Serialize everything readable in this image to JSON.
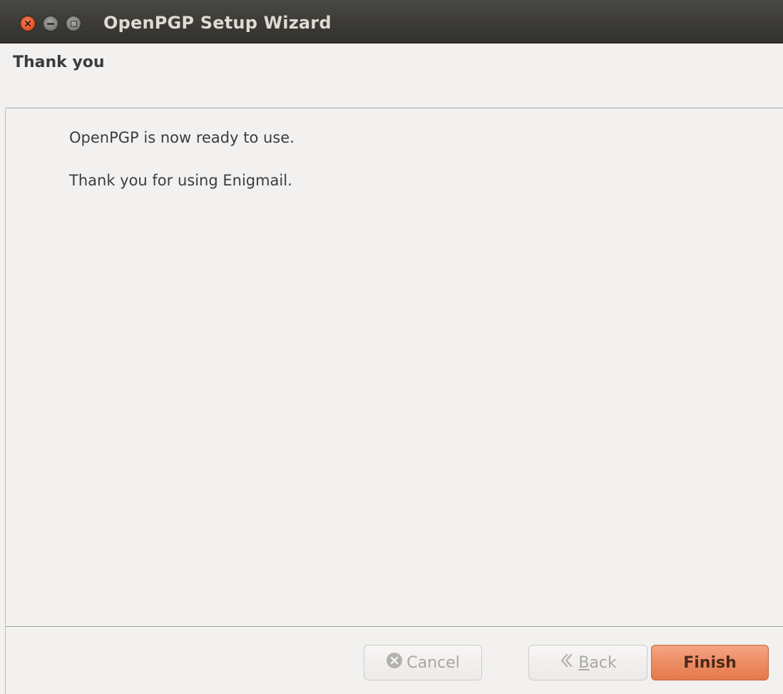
{
  "window": {
    "title": "OpenPGP Setup Wizard"
  },
  "header": {
    "heading": "Thank you"
  },
  "content": {
    "line1": "OpenPGP is now ready to use.",
    "line2": "Thank you for using Enigmail."
  },
  "buttons": {
    "cancel_label": "Cancel",
    "back_mnemonic": "B",
    "back_rest": "ack",
    "finish_label": "Finish"
  },
  "icons": {
    "close": "close-icon",
    "minimize": "minimize-icon",
    "maximize": "maximize-icon",
    "cancel": "cancel-icon",
    "back": "back-arrow-icon"
  },
  "colors": {
    "accent": "#ec8a60",
    "titlebar": "#3b3a36",
    "background": "#f2f1f0"
  }
}
